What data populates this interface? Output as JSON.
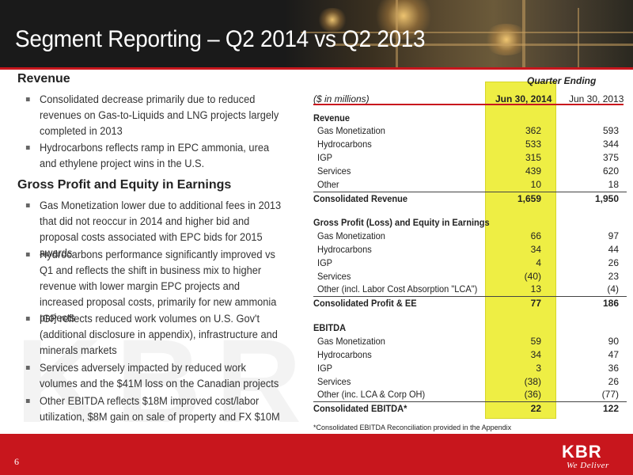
{
  "title": "Segment Reporting – Q2 2014 vs Q2 2013",
  "watermark": "KBR",
  "left": {
    "revenue_heading": "Revenue",
    "revenue_bullets": [
      "Consolidated decrease primarily due to reduced revenues on Gas-to-Liquids and LNG projects largely completed in 2013",
      "Hydrocarbons reflects ramp in EPC ammonia, urea and ethylene project wins in the U.S."
    ],
    "gp_heading": "Gross Profit and Equity in Earnings",
    "gp_bullets": [
      "Gas Monetization lower due to additional fees in 2013 that did not reoccur in 2014 and higher bid and proposal costs associated with EPC bids for 2015 awards",
      "Hydrocarbons performance significantly improved vs Q1 and reflects the shift in business mix to higher revenue with lower margin EPC projects and increased proposal costs, primarily for new ammonia projects",
      "IGP reflects reduced work volumes on U.S. Gov't (additional disclosure in appendix), infrastructure and minerals markets",
      "Services adversely impacted by reduced work volumes and the $41M loss on the Canadian projects",
      "Other EBITDA reflects $18M improved cost/labor utilization, $8M gain on sale of property and FX  $10M"
    ]
  },
  "table": {
    "quarter_ending": "Quarter Ending",
    "units": "($ in millions)",
    "col1": "Jun 30, 2014",
    "col2": "Jun 30, 2013",
    "revenue_title": "Revenue",
    "revenue_rows": [
      {
        "label": "Gas Monetization",
        "v1": "362",
        "v2": "593"
      },
      {
        "label": "Hydrocarbons",
        "v1": "533",
        "v2": "344"
      },
      {
        "label": "IGP",
        "v1": "315",
        "v2": "375"
      },
      {
        "label": "Services",
        "v1": "439",
        "v2": "620"
      },
      {
        "label": "Other",
        "v1": "10",
        "v2": "18"
      }
    ],
    "revenue_total": {
      "label": "Consolidated Revenue",
      "v1": "1,659",
      "v2": "1,950"
    },
    "gp_title": "Gross Profit (Loss) and Equity in Earnings",
    "gp_rows": [
      {
        "label": "Gas Monetization",
        "v1": "66",
        "v2": "97"
      },
      {
        "label": "Hydrocarbons",
        "v1": "34",
        "v2": "44"
      },
      {
        "label": "IGP",
        "v1": "4",
        "v2": "26"
      },
      {
        "label": "Services",
        "v1": "(40)",
        "v2": "23"
      },
      {
        "label": "Other (incl. Labor Cost Absorption \"LCA\")",
        "v1": "13",
        "v2": "(4)"
      }
    ],
    "gp_total": {
      "label": "Consolidated Profit & EE",
      "v1": "77",
      "v2": "186"
    },
    "ebitda_title": "EBITDA",
    "ebitda_rows": [
      {
        "label": "Gas Monetization",
        "v1": "59",
        "v2": "90"
      },
      {
        "label": "Hydrocarbons",
        "v1": "34",
        "v2": "47"
      },
      {
        "label": "IGP",
        "v1": "3",
        "v2": "36"
      },
      {
        "label": "Services",
        "v1": "(38)",
        "v2": "26"
      },
      {
        "label": "Other (inc. LCA & Corp OH)",
        "v1": "(36)",
        "v2": "(77)"
      }
    ],
    "ebitda_total": {
      "label": "Consolidated EBITDA*",
      "v1": "22",
      "v2": "122"
    },
    "footnote": "*Consolidated EBITDA Reconciliation provided in the Appendix"
  },
  "footer": {
    "page_number": "6",
    "logo": "KBR",
    "tagline": "We Deliver"
  },
  "colors": {
    "brand_red": "#c8161d",
    "highlight": "#eeee44",
    "header_dark": "#1a1a1a"
  }
}
